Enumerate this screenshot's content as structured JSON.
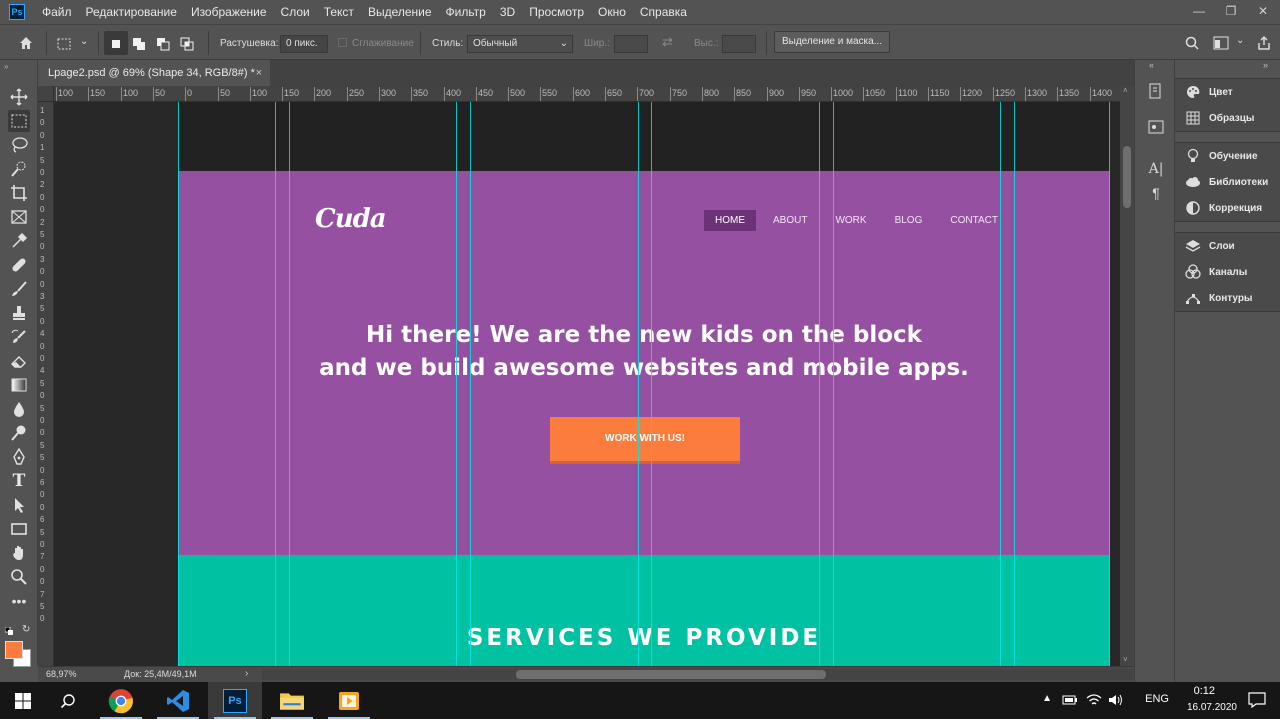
{
  "app": {
    "logo_text": "Ps"
  },
  "menu": [
    "Файл",
    "Редактирование",
    "Изображение",
    "Слои",
    "Текст",
    "Выделение",
    "Фильтр",
    "3D",
    "Просмотр",
    "Окно",
    "Справка"
  ],
  "window_controls": [
    "minimize-icon",
    "restore-icon",
    "close-icon"
  ],
  "options": {
    "feather_label": "Растушевка:",
    "feather_value": "0 пикс.",
    "antialias_label": "Сглаживание",
    "style_label": "Стиль:",
    "style_value": "Обычный",
    "width_label": "Шир.:",
    "height_label": "Выс.:",
    "mask_button": "Выделение и маска..."
  },
  "document": {
    "tab_title": "Lpage2.psd @ 69% (Shape 34, RGB/8#) *",
    "close": "×"
  },
  "ruler": {
    "h_labels": [
      "100",
      "150",
      "100",
      "50",
      "0",
      "50",
      "100",
      "150",
      "200",
      "250",
      "300",
      "350",
      "400",
      "450",
      "500",
      "550",
      "600",
      "650",
      "700",
      "750",
      "800",
      "850",
      "900",
      "950",
      "1000",
      "1050",
      "1100",
      "1150",
      "1200",
      "1250",
      "1300",
      "1350",
      "1400"
    ],
    "v_labels": [
      "1",
      "0",
      "0",
      "1",
      "5",
      "0",
      "2",
      "0",
      "0",
      "2",
      "5",
      "0",
      "3",
      "0",
      "0",
      "3",
      "5",
      "0",
      "4",
      "0",
      "0",
      "4",
      "5",
      "0",
      "5",
      "0",
      "0",
      "5",
      "5",
      "0",
      "6",
      "0",
      "0",
      "6",
      "5",
      "0",
      "7",
      "0",
      "0",
      "7",
      "5",
      "0"
    ]
  },
  "site": {
    "logo": "Cuda",
    "nav": [
      "HOME",
      "ABOUT",
      "WORK",
      "BLOG",
      "CONTACT"
    ],
    "nav_active": "HOME",
    "headline_line1": "Hi there! We are the new kids on the block",
    "headline_line2": "and we build awesome websites and mobile apps.",
    "cta": "WORK WITH US!",
    "services_title": "SERVICES WE PROVIDE",
    "colors": {
      "hero": "#9650a2",
      "services": "#00c2a3",
      "cta": "#fb7c3c",
      "nav_active": "#6c3278",
      "guide": "#00e6e6"
    }
  },
  "status": {
    "zoom": "68,97%",
    "doc_size": "Док: 25,4M/49,1M",
    "arrow": "›"
  },
  "panels": {
    "group1": [
      {
        "label": "Цвет",
        "icon": "palette-icon"
      },
      {
        "label": "Образцы",
        "icon": "grid-icon"
      }
    ],
    "group2": [
      {
        "label": "Обучение",
        "icon": "bulb-icon"
      },
      {
        "label": "Библиотеки",
        "icon": "cloud-icon"
      },
      {
        "label": "Коррекция",
        "icon": "half-circle-icon"
      }
    ],
    "group3": [
      {
        "label": "Слои",
        "icon": "layers-icon"
      },
      {
        "label": "Каналы",
        "icon": "channels-icon"
      },
      {
        "label": "Контуры",
        "icon": "paths-icon"
      }
    ]
  },
  "taskbar": {
    "lang": "ENG",
    "time": "0:12",
    "date": "16.07.2020",
    "apps": [
      "chrome-icon",
      "vscode-icon",
      "photoshop-icon",
      "explorer-icon",
      "media-icon"
    ]
  }
}
